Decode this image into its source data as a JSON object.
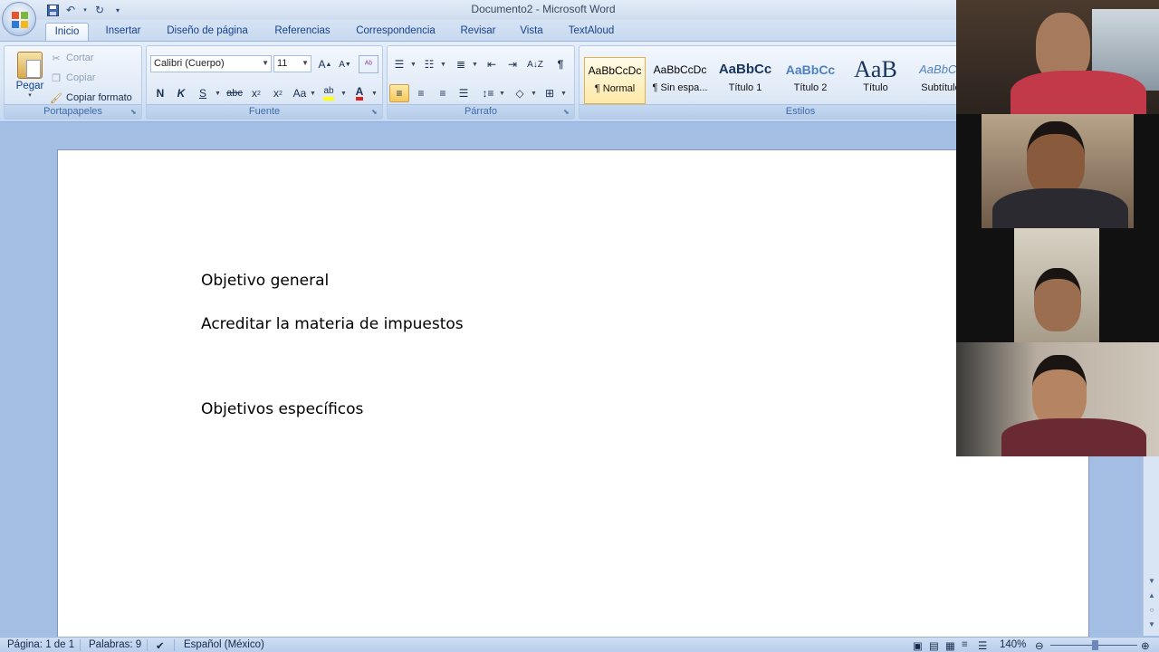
{
  "window": {
    "title": "Documento2 - Microsoft Word"
  },
  "tabs": [
    {
      "label": "Inicio",
      "active": true
    },
    {
      "label": "Insertar"
    },
    {
      "label": "Diseño de página"
    },
    {
      "label": "Referencias"
    },
    {
      "label": "Correspondencia"
    },
    {
      "label": "Revisar"
    },
    {
      "label": "Vista"
    },
    {
      "label": "TextAloud"
    }
  ],
  "ribbon": {
    "clipboard": {
      "label": "Portapapeles",
      "paste": "Pegar",
      "cut": "Cortar",
      "copy": "Copiar",
      "format_painter": "Copiar formato"
    },
    "font": {
      "label": "Fuente",
      "font_name": "Calibri (Cuerpo)",
      "font_size": "11",
      "bold": "N",
      "italic": "K",
      "underline": "S",
      "strike": "abc",
      "change_case": "Aa"
    },
    "paragraph": {
      "label": "Párrafo"
    },
    "styles": {
      "label": "Estilos",
      "items": [
        {
          "preview": "AaBbCcDc",
          "name": "¶ Normal",
          "selected": true
        },
        {
          "preview": "AaBbCcDc",
          "name": "¶ Sin espa..."
        },
        {
          "preview": "AaBbCc",
          "name": "Título 1"
        },
        {
          "preview": "AaBbCc",
          "name": "Título 2"
        },
        {
          "preview": "AaB",
          "name": "Título"
        },
        {
          "preview": "AaBbCc",
          "name": "Subtítulo"
        }
      ]
    }
  },
  "document": {
    "lines": [
      "Objetivo general",
      "Acreditar la materia de impuestos",
      "Objetivos específicos"
    ]
  },
  "status": {
    "page": "Página: 1 de 1",
    "words": "Palabras: 9",
    "language": "Español (México)",
    "zoom": "140%"
  },
  "video_call": {
    "participants": 4
  }
}
